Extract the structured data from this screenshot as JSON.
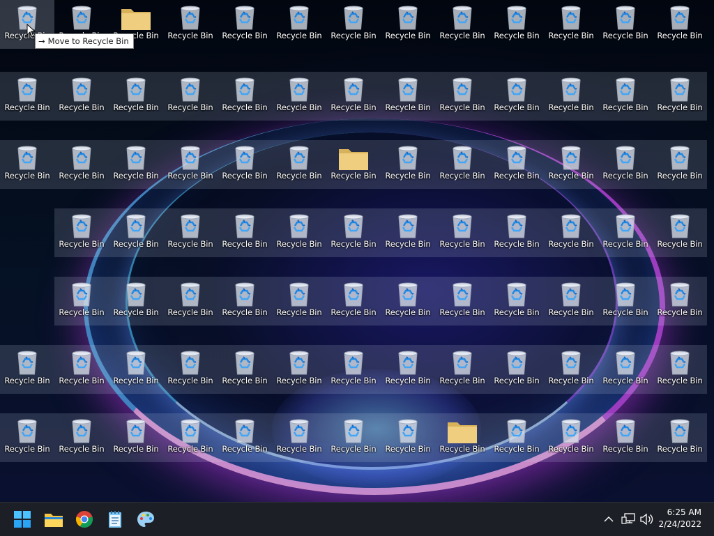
{
  "desktop": {
    "icon_label": "Recycle Bin",
    "folder_cells": [
      [
        0,
        2
      ],
      [
        2,
        6
      ],
      [
        6,
        8
      ]
    ],
    "tooltip": {
      "arrow": "→",
      "text": "Move to Recycle Bin"
    }
  },
  "taskbar": {
    "apps": [
      {
        "name": "start-button",
        "icon": "windows-logo-icon"
      },
      {
        "name": "file-explorer-button",
        "icon": "folder-icon"
      },
      {
        "name": "chrome-button",
        "icon": "chrome-icon"
      },
      {
        "name": "notepad-button",
        "icon": "notepad-icon"
      },
      {
        "name": "paint-button",
        "icon": "paint-icon"
      }
    ],
    "tray": {
      "chevron": "^",
      "icons": [
        "network-icon",
        "volume-icon"
      ]
    },
    "clock": {
      "time": "6:25 AM",
      "date": "2/24/2022"
    }
  },
  "colors": {
    "accent": "#0078d4",
    "taskbar_bg": "#1c1f26",
    "folder": "#e8c66a"
  }
}
